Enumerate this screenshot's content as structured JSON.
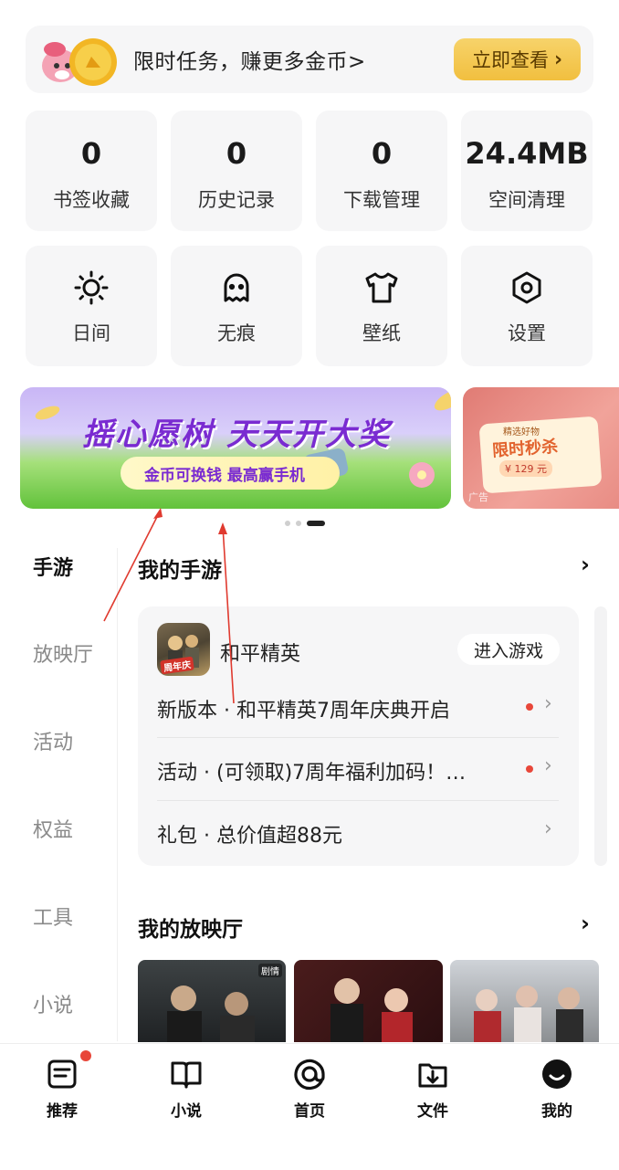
{
  "task_banner": {
    "text": "限时任务，赚更多金币>",
    "button": "立即查看"
  },
  "stats": [
    {
      "value": "0",
      "label": "书签收藏"
    },
    {
      "value": "0",
      "label": "历史记录"
    },
    {
      "value": "0",
      "label": "下载管理"
    },
    {
      "value": "24.4MB",
      "label": "空间清理"
    }
  ],
  "tools": [
    {
      "icon": "sun-icon",
      "label": "日间"
    },
    {
      "icon": "ghost-icon",
      "label": "无痕"
    },
    {
      "icon": "shirt-icon",
      "label": "壁纸"
    },
    {
      "icon": "settings-hexagon-icon",
      "label": "设置"
    }
  ],
  "promo": {
    "title": "摇心愿树 天天开大奖",
    "pill": "金币可换钱 最高赢手机",
    "second_title": "限时秒杀",
    "second_tag": "精选好物",
    "second_price": "¥ 129 元",
    "ad_label": "广告"
  },
  "left_nav": [
    "手游",
    "放映厅",
    "活动",
    "权益",
    "工具",
    "小说"
  ],
  "games_section": {
    "title": "我的手游",
    "game_name": "和平精英",
    "game_badge": "周年庆",
    "enter_button": "进入游戏",
    "rows": [
      {
        "text": "新版本 · 和平精英7周年庆典开启",
        "unread": true
      },
      {
        "text": "活动 · (可领取)7周年福利加码！…",
        "unread": true
      },
      {
        "text": "礼包 · 总价值超88元",
        "unread": false
      }
    ]
  },
  "theater_section": {
    "title": "我的放映厅",
    "thumb_tag": "剧情"
  },
  "tabbar": [
    {
      "icon": "recommend-doc-icon",
      "label": "推荐"
    },
    {
      "icon": "book-icon",
      "label": "小说"
    },
    {
      "icon": "home-at-icon",
      "label": "首页"
    },
    {
      "icon": "file-download-icon",
      "label": "文件"
    },
    {
      "icon": "profile-face-icon",
      "label": "我的"
    }
  ],
  "colors": {
    "accent": "#f1bf3f",
    "badge": "#e8473a",
    "card_bg": "#f6f6f7",
    "annotation_arrow": "#e03a2f"
  }
}
